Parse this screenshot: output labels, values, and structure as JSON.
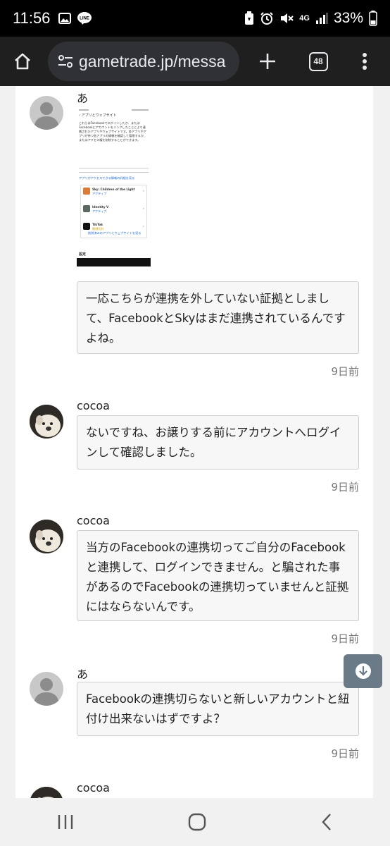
{
  "status": {
    "time": "11:56",
    "network": "4G",
    "battery": "33%"
  },
  "browser": {
    "url": "gametrade.jp/messa",
    "tab_count": "48"
  },
  "embedded_screenshot": {
    "header": "アプリとウェブサイト",
    "intro": "これらはFacebookでログインしたか、またはFacebookにアカウントをリンクしたことにより連携されたアプリやウェブサイトです。各アプリやアプリが持つ各アプリの情報を確認して管理するか、またはアクセス権を削除することができます。",
    "apps": [
      {
        "name": "Sky: Children of the Light",
        "status": "アクティブ"
      },
      {
        "name": "Identity V",
        "status": "アクティブ"
      },
      {
        "name": "TikTok",
        "status": "期限切れ"
      }
    ],
    "link": "アプリがアクセスできる情報の詳細を見る",
    "removed": "削除済みのアプリとウェブサイトを見る",
    "footer": "設定"
  },
  "messages": [
    {
      "user": "あ",
      "text": "一応こちらが連携を外していない証拠としまして、FacebookとSkyはまだ連携されているんですよね。",
      "time": "9日前"
    },
    {
      "user": "cocoa",
      "text": "ないですね、お譲りする前にアカウントへログインして確認しました。",
      "time": "9日前"
    },
    {
      "user": "cocoa",
      "text": "当方のFacebookの連携切ってご自分のFacebookと連携して、ログインできません。と騙された事があるのでFacebookの連携切っていませんと証拠にはならないんです。",
      "time": "9日前"
    },
    {
      "user": "あ",
      "text": "Facebookの連携切らないと新しいアカウントと紐付け出来ないはずですよ？",
      "time": "9日前"
    },
    {
      "user": "cocoa"
    }
  ]
}
